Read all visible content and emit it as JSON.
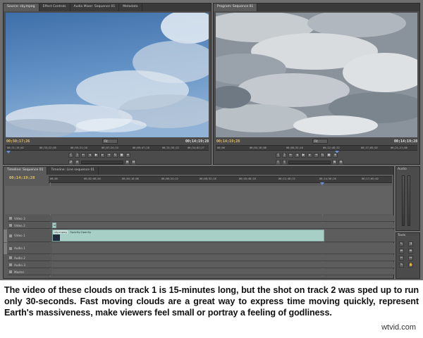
{
  "source_monitor": {
    "tabs": [
      "Source: sky.mpeg",
      "Effect Controls",
      "Audio Mixer: Sequence 01",
      "Metadata"
    ],
    "timecode_left": "00;50;17;26",
    "timecode_right": "00;14;19;28",
    "zoom": "Fit",
    "ruler_labels": [
      "00;11;15;02",
      "00;33;22;05",
      "00;55;21;10",
      "00;07;24;14",
      "00;09;47;18",
      "00;31;55;22",
      "00;34;02;27"
    ]
  },
  "program_monitor": {
    "tab": "Program: Sequence 01",
    "timecode_left": "00;14;19;28",
    "timecode_right": "00;14;19;28",
    "zoom": "Fit",
    "ruler_labels": [
      "00;00",
      "00;04;16;08",
      "00;08;32;16",
      "00;12;48;22",
      "00;17;05;02",
      "00;21;21;08"
    ]
  },
  "timeline": {
    "tabs": [
      "Timeline: Sequence 01",
      "Timeline: Line sequence 01"
    ],
    "timecode": "00;14;19;28",
    "ruler_labels": [
      "00;00",
      "00;02;08;04",
      "00;04;16;08",
      "00;06;24;12",
      "00;08;32;16",
      "00;10;40;18",
      "00;12;48;22",
      "00;14;56;26",
      "00;17;05;02"
    ],
    "tracks": [
      {
        "name": "Video 3",
        "kind": "video"
      },
      {
        "name": "Video 2",
        "kind": "video"
      },
      {
        "name": "Video 1",
        "kind": "video"
      },
      {
        "name": "Audio 1",
        "kind": "audio"
      },
      {
        "name": "Audio 2",
        "kind": "audio"
      },
      {
        "name": "Audio 3",
        "kind": "audio"
      },
      {
        "name": "Master",
        "kind": "audio"
      }
    ],
    "clips": {
      "video2_label": "sky",
      "video1_label": "sky.mpeg",
      "video1_effect": "Opacity:Opacity"
    }
  },
  "side_panels": {
    "audio_title": "Audio",
    "tools_title": "Tools"
  },
  "caption": "The video of these clouds on track 1 is 15-minutes long, but the shot on track 2 was sped up to run only 30-seconds. Fast moving clouds are a great way to express time moving quickly, represent Earth's massiveness, make viewers feel small or portray a feeling of godliness.",
  "watermark": "wtvid.com",
  "colors": {
    "timecode": "#e5c46a",
    "clip": "#a8cfc6",
    "panel": "#4b4b4b",
    "playhead": "#6a8fd9"
  }
}
